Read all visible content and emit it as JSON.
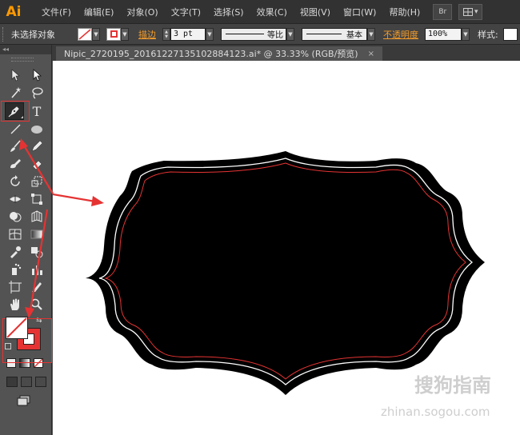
{
  "menubar": {
    "logo": "Ai",
    "items": [
      "文件(F)",
      "编辑(E)",
      "对象(O)",
      "文字(T)",
      "选择(S)",
      "效果(C)",
      "视图(V)",
      "窗口(W)",
      "帮助(H)"
    ],
    "bridge_label": "Br",
    "arrange_label": "▾"
  },
  "controlbar": {
    "selection_label": "未选择对象",
    "stroke_label": "描边",
    "stroke_weight": "3 pt",
    "profile_label": "等比",
    "brush_label": "基本",
    "opacity_label": "不透明度",
    "opacity_value": "100%",
    "style_label": "样式:"
  },
  "document_tab": {
    "title": "Nipic_2720195_20161227135102884123.ai* @ 33.33% (RGB/预览)",
    "close": "×"
  },
  "toolbox": {
    "collapse_glyph": "◂◂",
    "tools": [
      {
        "name": "selection-tool",
        "icon": "selection-arrow-icon"
      },
      {
        "name": "direct-selection-tool",
        "icon": "direct-selection-arrow-icon"
      },
      {
        "name": "magic-wand-tool",
        "icon": "magic-wand-icon"
      },
      {
        "name": "lasso-tool",
        "icon": "lasso-icon"
      },
      {
        "name": "pen-tool",
        "icon": "pen-icon"
      },
      {
        "name": "type-tool",
        "icon": "type-icon",
        "glyph": "T"
      },
      {
        "name": "line-tool",
        "icon": "line-icon"
      },
      {
        "name": "ellipse-tool",
        "icon": "ellipse-icon"
      },
      {
        "name": "paintbrush-tool",
        "icon": "paintbrush-icon"
      },
      {
        "name": "pencil-tool",
        "icon": "pencil-icon"
      },
      {
        "name": "blob-brush-tool",
        "icon": "blob-brush-icon"
      },
      {
        "name": "eraser-tool",
        "icon": "eraser-icon"
      },
      {
        "name": "rotate-tool",
        "icon": "rotate-icon"
      },
      {
        "name": "scale-tool",
        "icon": "scale-icon"
      },
      {
        "name": "width-tool",
        "icon": "width-icon"
      },
      {
        "name": "free-transform-tool",
        "icon": "free-transform-icon"
      },
      {
        "name": "shape-builder-tool",
        "icon": "shape-builder-icon"
      },
      {
        "name": "perspective-grid-tool",
        "icon": "perspective-grid-icon"
      },
      {
        "name": "mesh-tool",
        "icon": "mesh-icon"
      },
      {
        "name": "gradient-tool",
        "icon": "gradient-icon"
      },
      {
        "name": "eyedropper-tool",
        "icon": "eyedropper-icon"
      },
      {
        "name": "blend-tool",
        "icon": "blend-icon"
      },
      {
        "name": "symbol-sprayer-tool",
        "icon": "symbol-sprayer-icon"
      },
      {
        "name": "column-graph-tool",
        "icon": "column-graph-icon"
      },
      {
        "name": "artboard-tool",
        "icon": "artboard-icon"
      },
      {
        "name": "slice-tool",
        "icon": "slice-icon"
      },
      {
        "name": "hand-tool",
        "icon": "hand-icon"
      },
      {
        "name": "zoom-tool",
        "icon": "zoom-icon"
      }
    ]
  },
  "colors": {
    "menubar_bg": "#323232",
    "panel_bg": "#535353",
    "accent_orange": "#f29b2a",
    "stroke_color": "#e53333",
    "shape_fill": "#000000",
    "canvas_bg": "#ffffff"
  },
  "watermark": {
    "brand": "搜狗指南",
    "url": "zhinan.sogou.com"
  }
}
